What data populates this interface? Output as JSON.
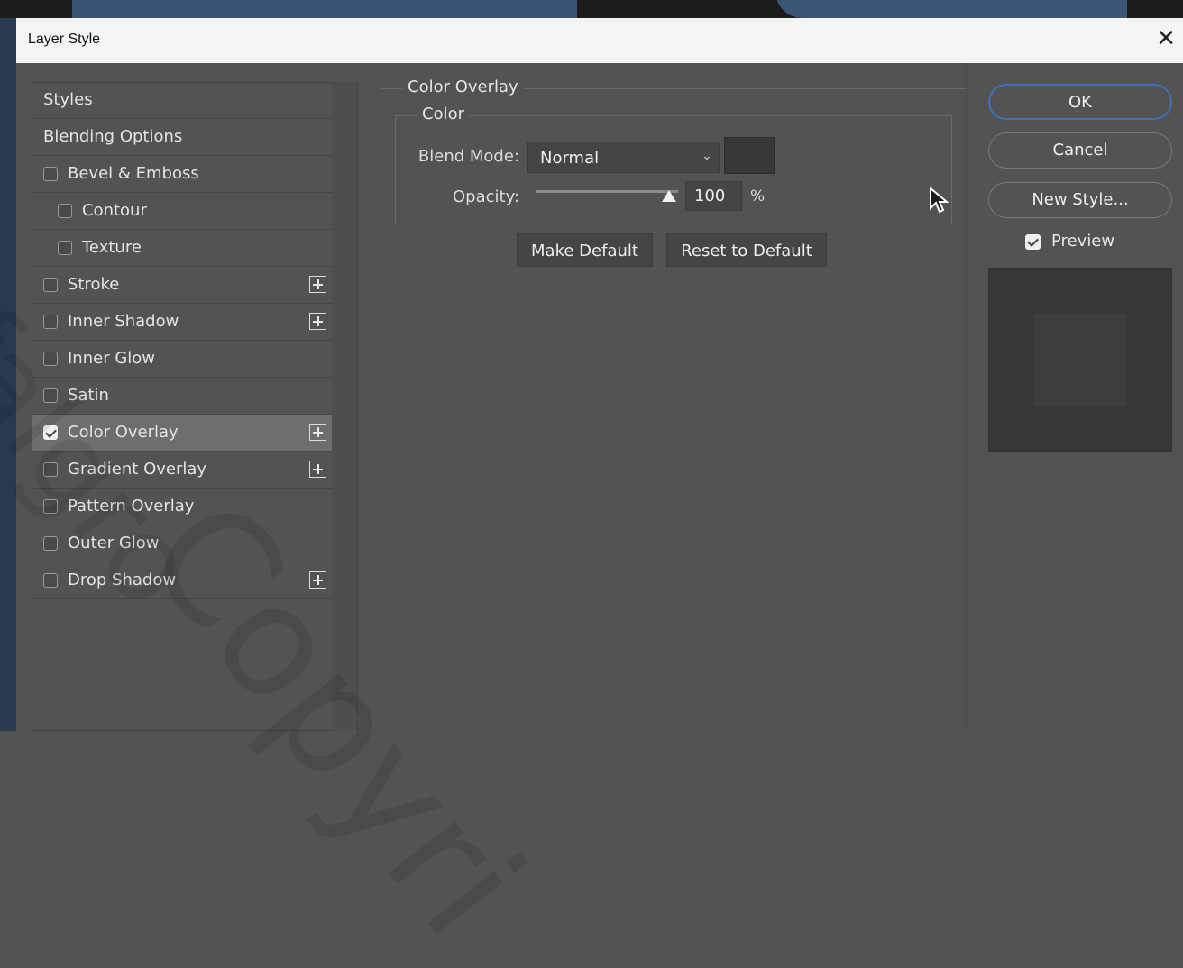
{
  "window": {
    "title": "Layer Style",
    "close_glyph": "✕"
  },
  "styles_list": [
    {
      "label": "Styles",
      "checkbox": false
    },
    {
      "label": "Blending Options",
      "checkbox": false
    },
    {
      "label": "Bevel & Emboss",
      "checkbox": true,
      "checked": false
    },
    {
      "label": "Contour",
      "checkbox": true,
      "checked": false,
      "indent": true
    },
    {
      "label": "Texture",
      "checkbox": true,
      "checked": false,
      "indent": true
    },
    {
      "label": "Stroke",
      "checkbox": true,
      "checked": false,
      "plus": true
    },
    {
      "label": "Inner Shadow",
      "checkbox": true,
      "checked": false,
      "plus": true
    },
    {
      "label": "Inner Glow",
      "checkbox": true,
      "checked": false
    },
    {
      "label": "Satin",
      "checkbox": true,
      "checked": false
    },
    {
      "label": "Color Overlay",
      "checkbox": true,
      "checked": true,
      "plus": true,
      "selected": true
    },
    {
      "label": "Gradient Overlay",
      "checkbox": true,
      "checked": false,
      "plus": true
    },
    {
      "label": "Pattern Overlay",
      "checkbox": true,
      "checked": false
    },
    {
      "label": "Outer Glow",
      "checkbox": true,
      "checked": false
    },
    {
      "label": "Drop Shadow",
      "checkbox": true,
      "checked": false,
      "plus": true
    }
  ],
  "color_overlay": {
    "group_title": "Color Overlay",
    "subgroup_title": "Color",
    "blend_mode_label": "Blend Mode:",
    "blend_mode_value": "Normal",
    "swatch_color": "#383838",
    "opacity_label": "Opacity:",
    "opacity_value": "100",
    "opacity_unit": "%",
    "opacity_level": 1.0,
    "make_default_label": "Make Default",
    "reset_default_label": "Reset to Default"
  },
  "actions": {
    "ok_label": "OK",
    "cancel_label": "Cancel",
    "new_style_label": "New Style...",
    "preview_label": "Preview",
    "preview_checked": true
  },
  "watermark": {
    "text1": "Copyri",
    "text2": "Tfalgro"
  },
  "colors": {
    "accent": "#3f6fc0",
    "dialog_bg": "#535353"
  }
}
